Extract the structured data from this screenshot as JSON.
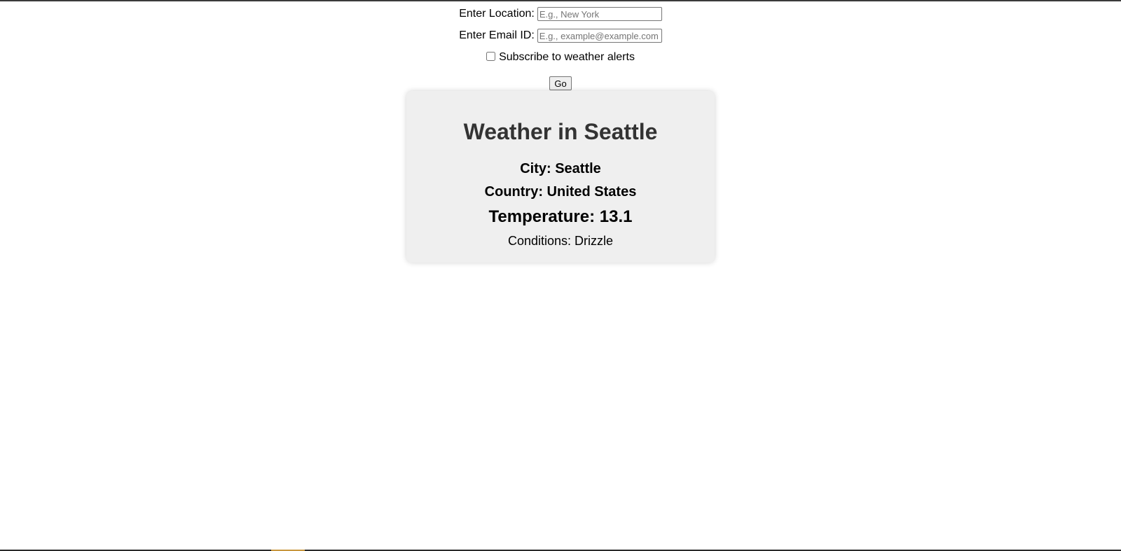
{
  "form": {
    "location_label": "Enter Location:",
    "location_placeholder": "E.g., New York",
    "location_value": "",
    "email_label": "Enter Email ID:",
    "email_placeholder": "E.g., example@example.com",
    "email_value": "",
    "subscribe_label": "Subscribe to weather alerts",
    "subscribe_checked": false,
    "go_label": "Go"
  },
  "weather": {
    "title": "Weather in Seattle",
    "city_line": "City: Seattle",
    "country_line": "Country: United States",
    "temperature_line": "Temperature: 13.1",
    "conditions_line": "Conditions: Drizzle"
  },
  "colors": {
    "card_background": "#efefef",
    "title_color": "#333333",
    "page_background": "#ffffff"
  }
}
